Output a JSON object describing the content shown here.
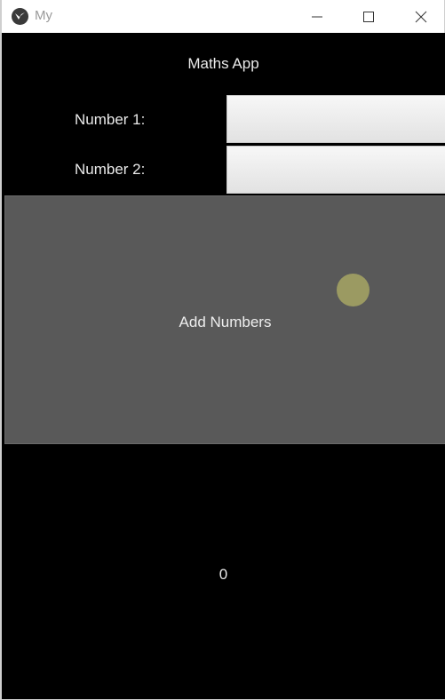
{
  "window": {
    "title": "My",
    "icon": "kivy-logo-icon",
    "controls": {
      "minimize": "minimize-icon",
      "maximize": "maximize-icon",
      "close": "close-icon"
    }
  },
  "app": {
    "title": "Maths App",
    "number1_label": "Number 1:",
    "number1_value": "",
    "number2_label": "Number 2:",
    "number2_value": "",
    "add_button_label": "Add Numbers",
    "result": "0"
  },
  "colors": {
    "background": "#000000",
    "button": "#595959",
    "touch_indicator": "#9b9a62",
    "text": "#eaeaea"
  }
}
